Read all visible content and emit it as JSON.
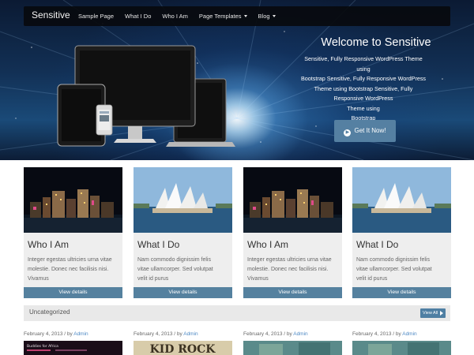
{
  "navbar": {
    "brand": "Sensitive",
    "items": [
      {
        "label": "Sample Page",
        "dropdown": false
      },
      {
        "label": "What I Do",
        "dropdown": false
      },
      {
        "label": "Who I Am",
        "dropdown": false
      },
      {
        "label": "Page Templates",
        "dropdown": true
      },
      {
        "label": "Blog",
        "dropdown": true
      }
    ]
  },
  "hero": {
    "title": "Welcome to Sensitive",
    "subtitle_lines": [
      "Sensitive, Fully Responsive WordPress Theme using",
      "Bootstrap Sensitive, Fully Responsive WordPress",
      "Theme using Bootstrap Sensitive, Fully",
      "Responsive WordPress",
      "Theme using",
      "Bootstrap"
    ],
    "cta_label": "Get It Now!",
    "cta_icon": "arrow-circle-icon"
  },
  "cards": [
    {
      "title": "Who I Am",
      "text_lines": [
        "Integer egestas ultricies urna vitae",
        "molestie. Donec nec facilisis nisi.",
        "Vivamus"
      ],
      "button": "View details",
      "image": "city-night"
    },
    {
      "title": "What I Do",
      "text_lines": [
        "Nam commodo dignissim felis",
        "vitae ullamcorper. Sed volutpat",
        "velit id purus"
      ],
      "button": "View details",
      "image": "opera-house"
    },
    {
      "title": "Who I Am",
      "text_lines": [
        "Integer egestas ultricies urna vitae",
        "molestie. Donec nec facilisis nisi.",
        "Vivamus"
      ],
      "button": "View details",
      "image": "city-night"
    },
    {
      "title": "What I Do",
      "text_lines": [
        "Nam commodo dignissim felis",
        "vitae ullamcorper. Sed volutpat",
        "velit id purus"
      ],
      "button": "View details",
      "image": "opera-house"
    }
  ],
  "category": {
    "label": "Uncategorized",
    "view_all": "View All"
  },
  "posts": [
    {
      "date": "February 4, 2013 / by ",
      "author": "Admin"
    },
    {
      "date": "February 4, 2013 / by ",
      "author": "Admin"
    },
    {
      "date": "February 4, 2013 / by ",
      "author": "Admin"
    },
    {
      "date": "February 4, 2013 / by ",
      "author": "Admin"
    }
  ],
  "post_thumbs": {
    "first_banner_text": "Buddies for Africa",
    "second_banner_text": "KID ROCK"
  },
  "colors": {
    "accent_button": "#5580a2",
    "card_button": "#55819f",
    "link": "#4d88c4",
    "navbar": "#0a0c10"
  }
}
